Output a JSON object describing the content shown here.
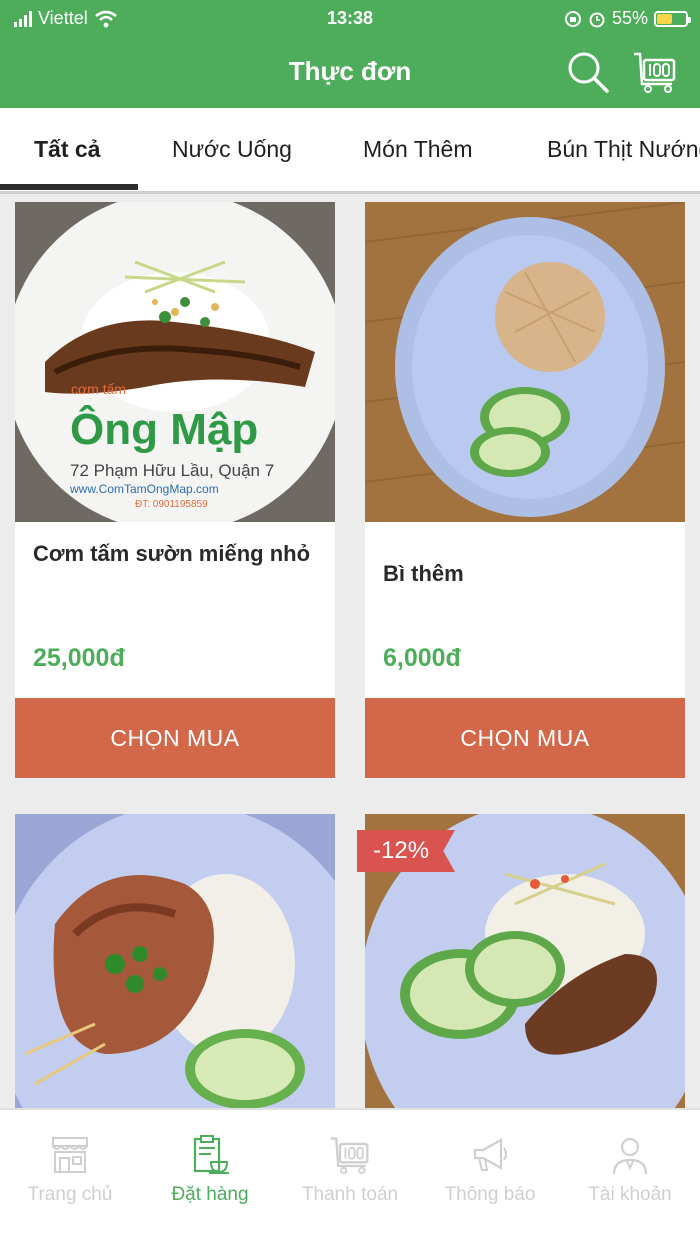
{
  "status_bar": {
    "carrier": "Viettel",
    "time": "13:38",
    "battery": "55%",
    "battery_level": 0.55
  },
  "header": {
    "title": "Thực đơn"
  },
  "tabs": [
    {
      "label": "Tất cả",
      "active": true
    },
    {
      "label": "Nước Uống",
      "active": false
    },
    {
      "label": "Món Thêm",
      "active": false
    },
    {
      "label": "Bún Thịt Nướng",
      "active": false
    }
  ],
  "products": [
    {
      "name": "Cơm tấm sườn miếng nhỏ",
      "price": "25,000đ",
      "button": "CHỌN MUA",
      "photo_text": {
        "small": "cơm tấm",
        "brand": "Ông Mập",
        "address": "72 Phạm Hữu Lầu, Quận 7",
        "site": "www.ComTamOngMap.com",
        "phone": "ĐT: 0901195859"
      }
    },
    {
      "name": "Bì thêm",
      "price": "6,000đ",
      "button": "CHỌN MUA"
    },
    {
      "name": "",
      "price": "",
      "button": ""
    },
    {
      "name": "",
      "price": "",
      "button": "",
      "discount": "-12%"
    }
  ],
  "bottom_nav": [
    {
      "label": "Trang chủ",
      "icon": "store-icon",
      "active": false
    },
    {
      "label": "Đặt hàng",
      "icon": "order-clipboard-icon",
      "active": true
    },
    {
      "label": "Thanh toán",
      "icon": "cart-icon",
      "active": false
    },
    {
      "label": "Thông báo",
      "icon": "megaphone-icon",
      "active": false
    },
    {
      "label": "Tài khoản",
      "icon": "user-icon",
      "active": false
    }
  ],
  "colors": {
    "primary": "#4ead5b",
    "buy_button": "#d3674a",
    "discount": "#d9534f",
    "inactive": "#cfcfcf"
  }
}
